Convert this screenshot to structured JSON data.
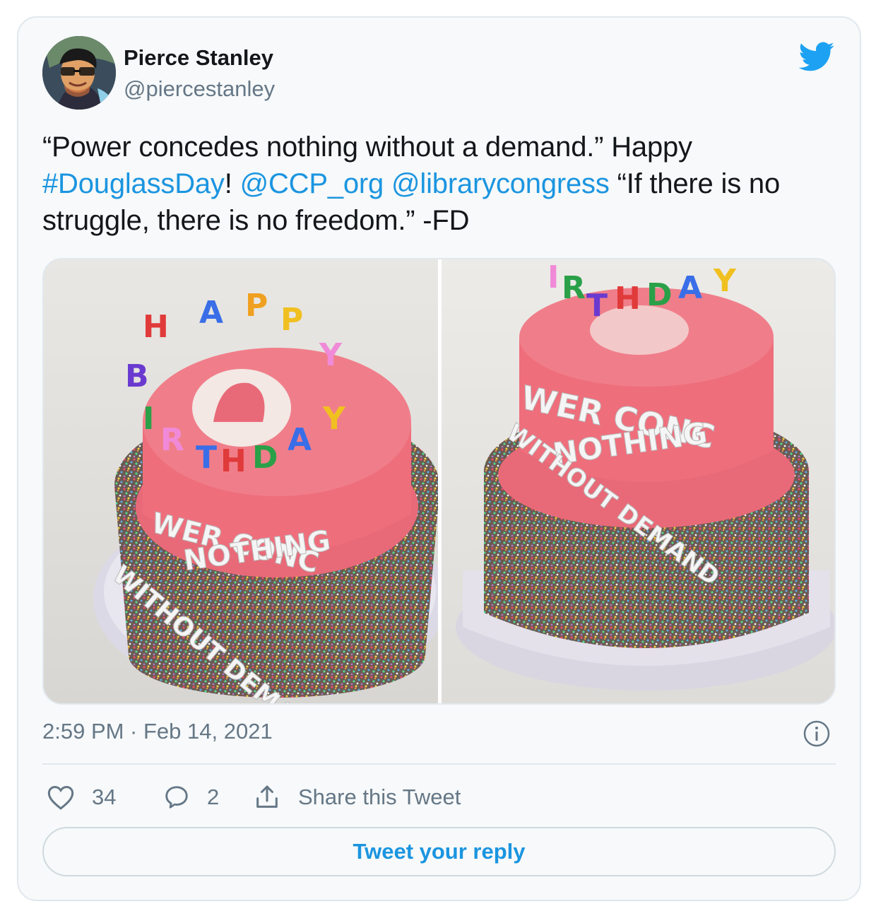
{
  "author": {
    "name": "Pierce Stanley",
    "handle": "@piercestanley",
    "avatar_icon": "avatar-illustration"
  },
  "brand": {
    "icon": "twitter-bird-icon",
    "color": "#1da1f2"
  },
  "tweet": {
    "text_part1": "“Power concedes nothing without a demand.” Happy ",
    "hashtag": "#DouglassDay",
    "text_part2": "! ",
    "mention1": "@CCP_org",
    "text_part3": " ",
    "mention2": "@librarycongress",
    "text_part4": " “If there is no struggle, there is no freedom.” -FD",
    "link_color": "#1b95e0"
  },
  "media": {
    "photos": [
      {
        "icon": "birthday-cake-photo",
        "candle_letters": [
          "H",
          "A",
          "P",
          "P",
          "Y",
          "B",
          "I",
          "R",
          "T",
          "H",
          "D",
          "A",
          "Y"
        ],
        "cake_lettering": [
          "WER CONC",
          "NOTHING",
          "WITHOUT DEMAND"
        ]
      },
      {
        "icon": "birthday-cake-photo",
        "candle_letters": [
          "I",
          "R",
          "T",
          "H",
          "D",
          "A",
          "Y"
        ],
        "cake_lettering": [
          "WER CONC",
          "NOTHING",
          "WITHOUT DEMAND"
        ]
      }
    ]
  },
  "timestamp": "2:59 PM · Feb 14, 2021",
  "actions": {
    "likes": "34",
    "replies": "2",
    "share_label": "Share this Tweet"
  },
  "reply_button": "Tweet your reply"
}
